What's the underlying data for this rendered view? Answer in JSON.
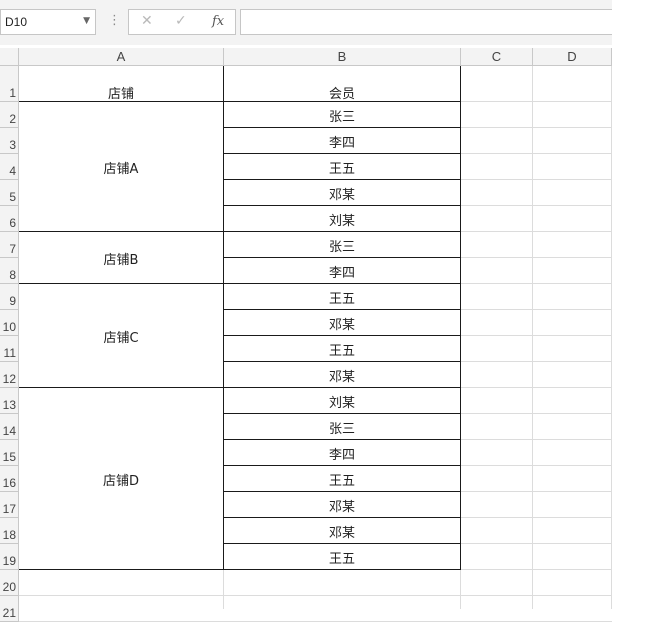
{
  "formula_bar": {
    "name_box_value": "D10",
    "more_glyph": "⋮",
    "cancel_glyph": "✕",
    "confirm_glyph": "✓",
    "fx_label": "fx",
    "formula_value": ""
  },
  "columns": [
    "A",
    "B",
    "C",
    "D"
  ],
  "rows": [
    "1",
    "2",
    "3",
    "4",
    "5",
    "6",
    "7",
    "8",
    "9",
    "10",
    "11",
    "12",
    "13",
    "14",
    "15",
    "16",
    "17",
    "18",
    "19",
    "20",
    "21"
  ],
  "table": {
    "header": {
      "store": "店铺",
      "member": "会员"
    },
    "groups": [
      {
        "store": "店铺A",
        "members": [
          "张三",
          "李四",
          "王五",
          "邓某",
          "刘某"
        ]
      },
      {
        "store": "店铺B",
        "members": [
          "张三",
          "李四"
        ]
      },
      {
        "store": "店铺C",
        "members": [
          "王五",
          "邓某",
          "王五",
          "邓某"
        ]
      },
      {
        "store": "店铺D",
        "members": [
          "刘某",
          "张三",
          "李四",
          "王五",
          "邓某",
          "邓某",
          "王五"
        ]
      }
    ]
  }
}
